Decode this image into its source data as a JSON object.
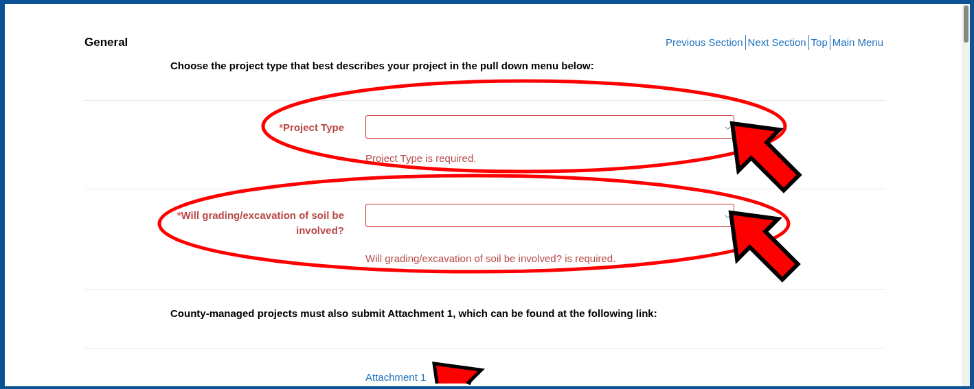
{
  "section": {
    "title": "General",
    "nav_links": [
      "Previous Section",
      "Next Section",
      "Top",
      "Main Menu"
    ]
  },
  "instruction": "Choose the project type that best describes your project in the pull down menu below:",
  "fields": [
    {
      "required_mark": "*",
      "label": "Project Type",
      "invalid": true,
      "error": "Project Type is required."
    },
    {
      "required_mark": "*",
      "label": "Will grading/excavation of soil be involved?",
      "invalid": true,
      "error": "Will grading/excavation of soil be involved? is required."
    }
  ],
  "note": "County-managed projects must also submit Attachment 1, which can be found at the following link:",
  "link": "Attachment 1",
  "annotations": [
    {
      "kind": "ellipse"
    },
    {
      "kind": "ellipse"
    },
    {
      "kind": "arrow"
    },
    {
      "kind": "arrow"
    },
    {
      "kind": "arrow"
    }
  ]
}
